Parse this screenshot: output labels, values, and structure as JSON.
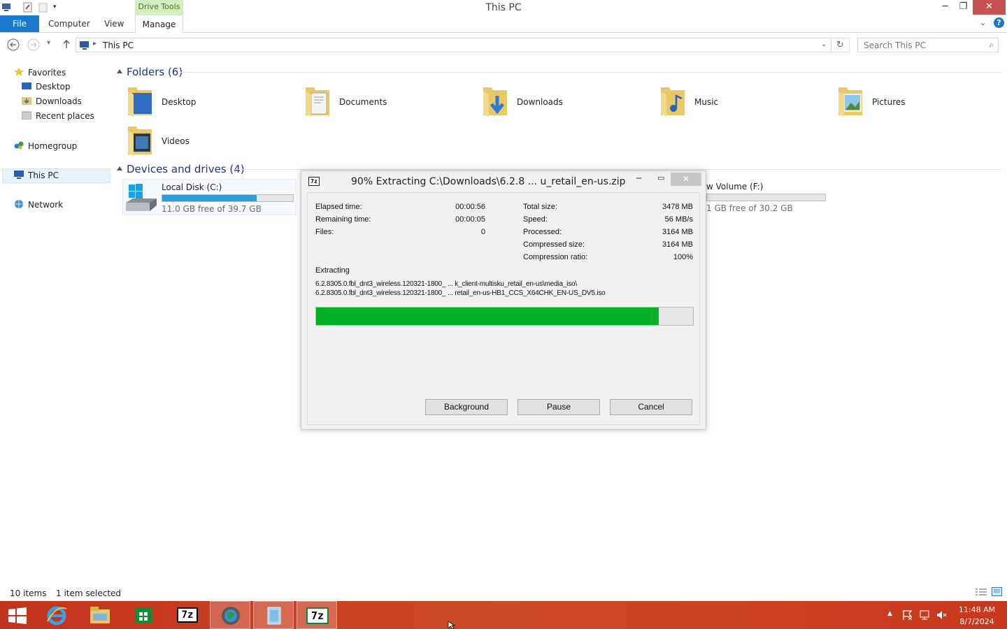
{
  "window": {
    "title": "This PC",
    "contextual_tab_group": "Drive Tools",
    "minimize": "─",
    "restore": "❐",
    "close": "✕"
  },
  "ribbon": {
    "tabs": [
      "File",
      "Computer",
      "View",
      "Manage"
    ]
  },
  "address": {
    "path": "This PC",
    "search_placeholder": "Search This PC"
  },
  "nav_pane": {
    "favorites": "Favorites",
    "favorites_items": [
      "Desktop",
      "Downloads",
      "Recent places"
    ],
    "homegroup": "Homegroup",
    "this_pc": "This PC",
    "network": "Network"
  },
  "content": {
    "folders_header": "Folders (6)",
    "folders": [
      "Desktop",
      "Documents",
      "Downloads",
      "Music",
      "Pictures",
      "Videos"
    ],
    "devices_header": "Devices and drives (4)",
    "drive_c": {
      "name": "Local Disk (C:)",
      "free": "11.0 GB free of 39.7 GB",
      "used_fraction": 0.72
    },
    "drive_f": {
      "name_partial": "w Volume (F:)",
      "free_partial": "1 GB free of 30.2 GB",
      "used_fraction": 0.0
    }
  },
  "status": {
    "items": "10 items",
    "selected": "1 item selected"
  },
  "taskbar": {
    "time": "11:48 AM",
    "date": "8/7/2024",
    "active_color": "#c8371d"
  },
  "dialog": {
    "title": "90% Extracting C:\\Downloads\\6.2.8 ... u_retail_en-us.zip",
    "icon_text": "7z",
    "left_stats": [
      {
        "label": "Elapsed time:",
        "value": "00:00:56"
      },
      {
        "label": "Remaining time:",
        "value": "00:00:05"
      },
      {
        "label": "Files:",
        "value": "0"
      }
    ],
    "right_stats": [
      {
        "label": "Total size:",
        "value": "3478 MB"
      },
      {
        "label": "Speed:",
        "value": "56 MB/s"
      },
      {
        "label": "Processed:",
        "value": "3164 MB"
      },
      {
        "label": "Compressed size:",
        "value": "3164 MB"
      },
      {
        "label": "Compression ratio:",
        "value": "100%"
      }
    ],
    "operation": "Extracting",
    "path_line1": "6.2.8305.0.fbl_dnt3_wireless.120321-1800_ ... k_client-multisku_retail_en-us\\media_iso\\",
    "path_line2": "6.2.8305.0.fbl_dnt3_wireless.120321-1800_ ... retail_en-us-HB1_CCS_X64CHK_EN-US_DV5.iso",
    "progress": 0.91,
    "buttons": {
      "background": "Background",
      "pause": "Pause",
      "cancel": "Cancel"
    }
  }
}
